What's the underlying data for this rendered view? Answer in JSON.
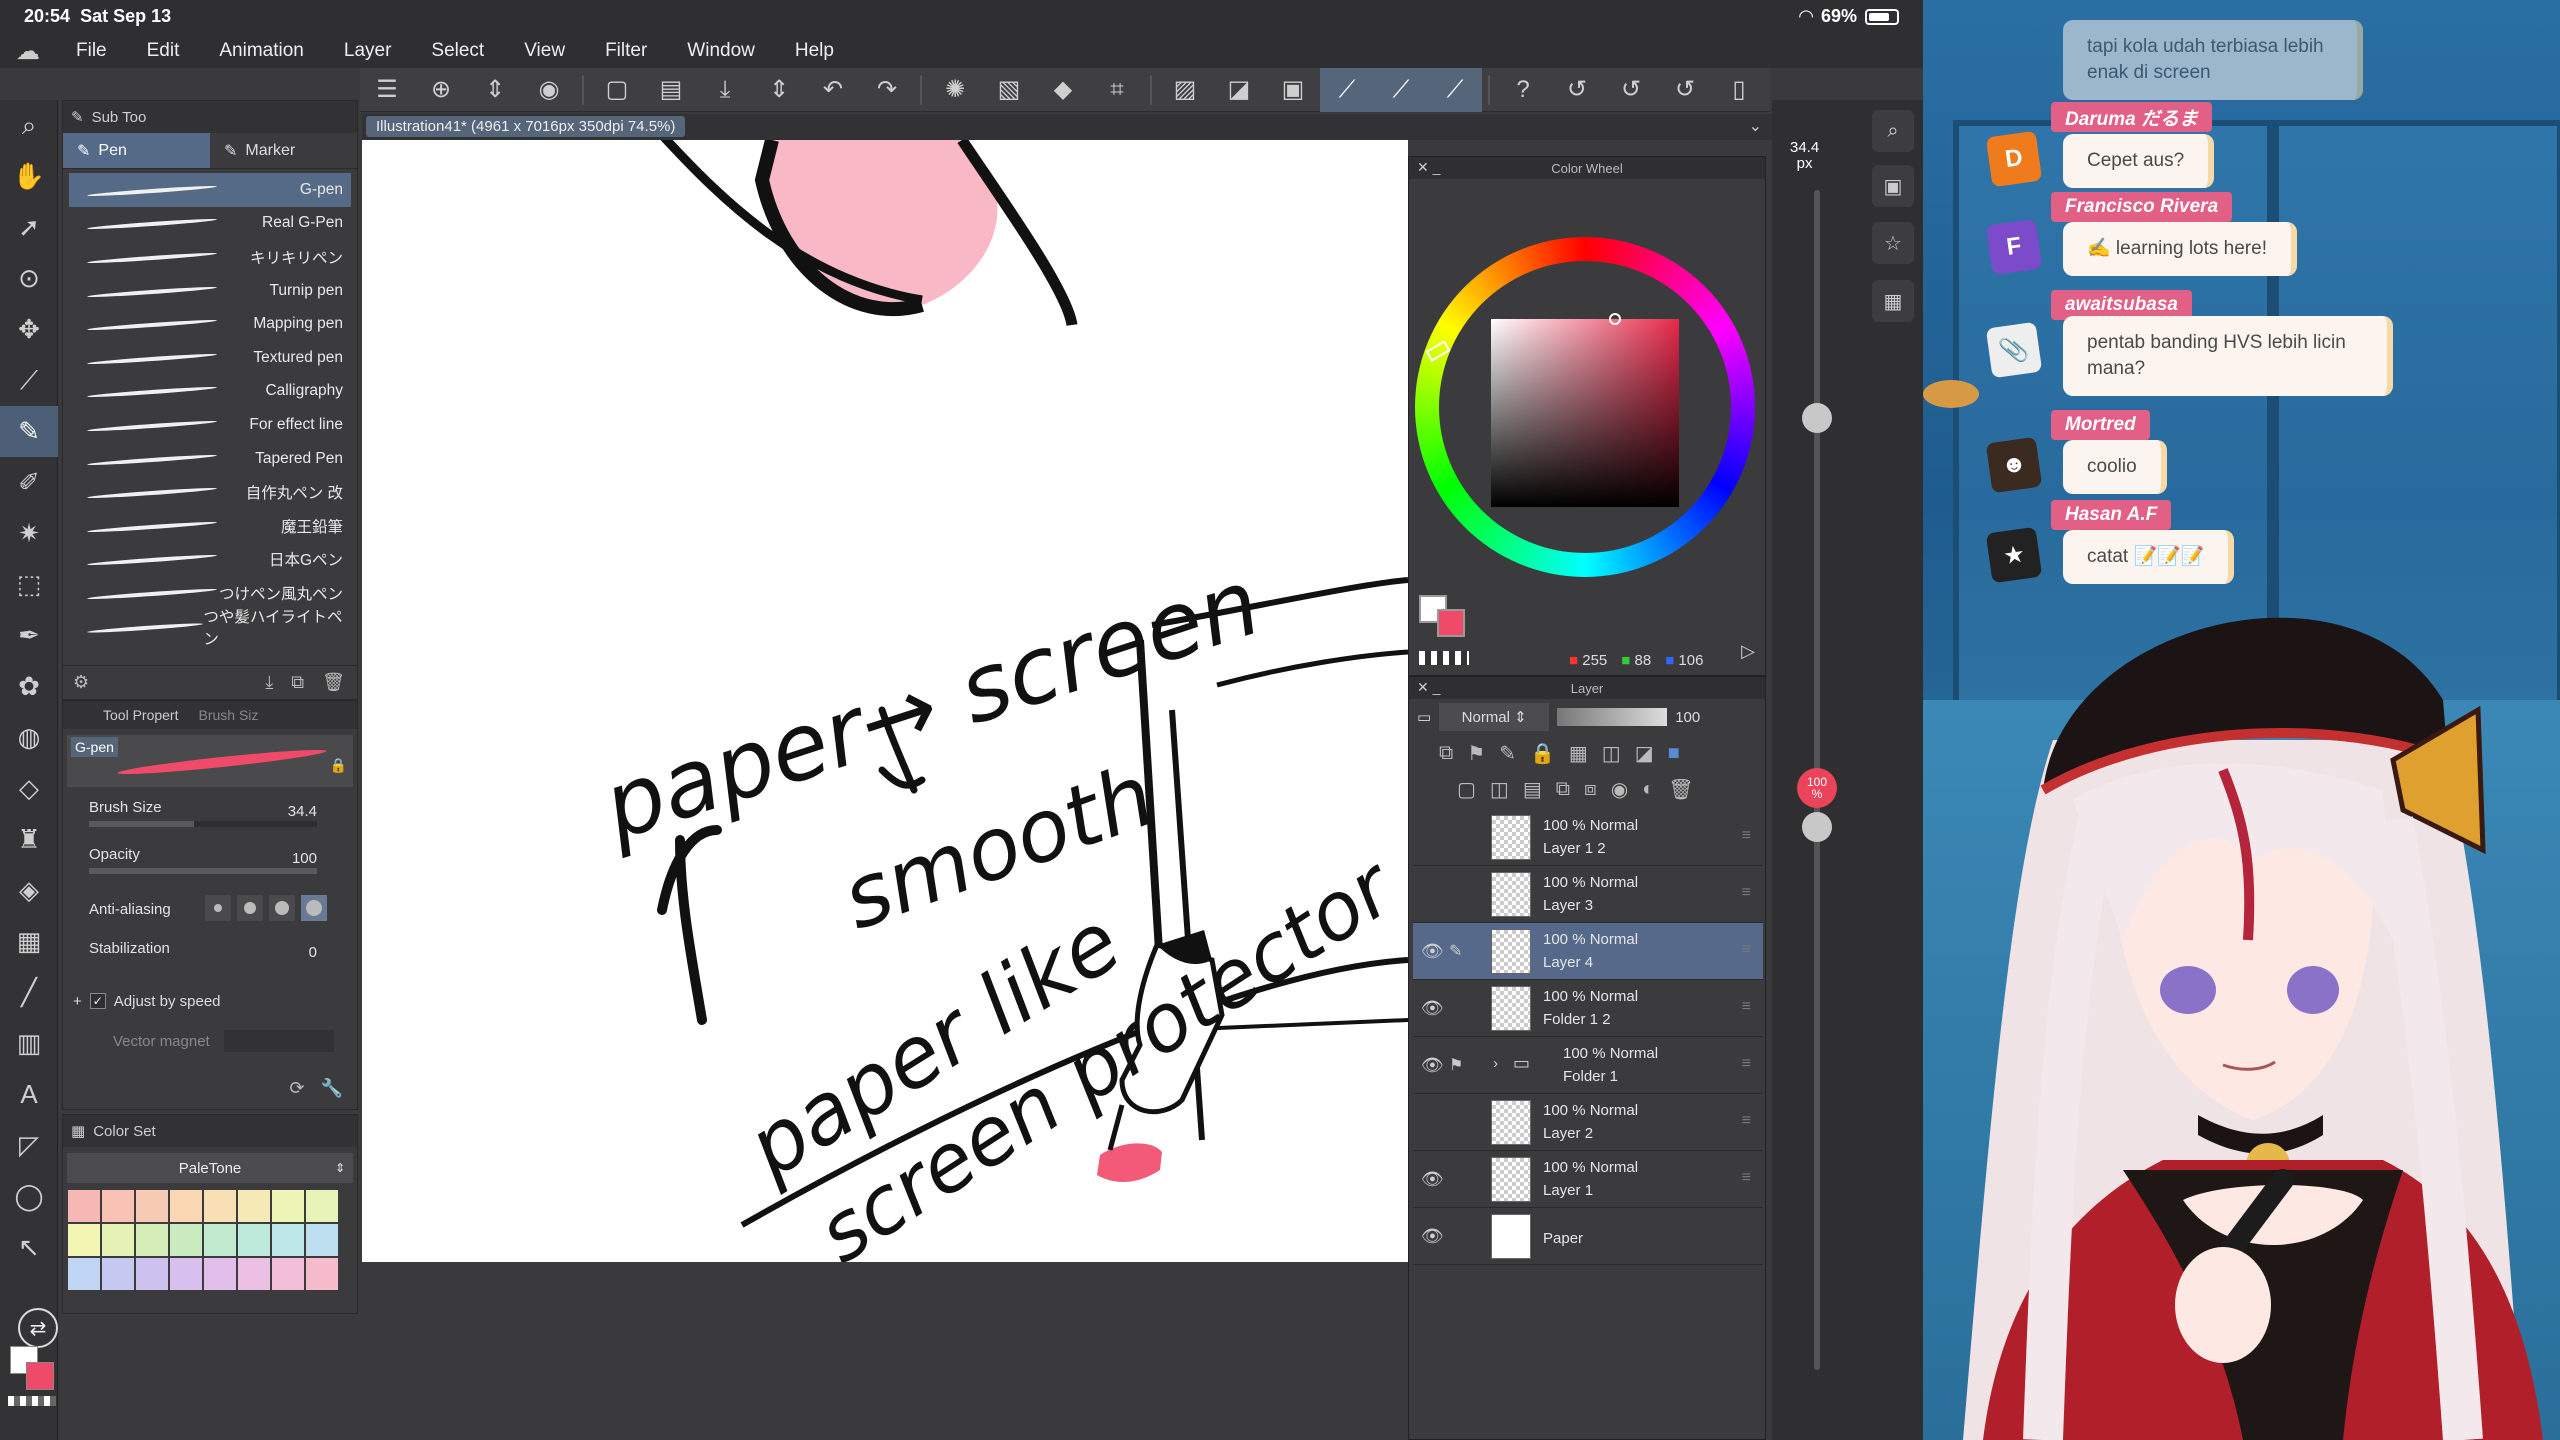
{
  "statusbar": {
    "time": "20:54",
    "date": "Sat Sep 13",
    "battery": "69%"
  },
  "menu": [
    "File",
    "Edit",
    "Animation",
    "Layer",
    "Select",
    "View",
    "Filter",
    "Window",
    "Help"
  ],
  "canvas_tab": "Illustration41* (4961 x 7016px 350dpi 74.5%)",
  "subtool": {
    "header": "Sub Too",
    "groups": [
      "Pen",
      "Marker"
    ],
    "brushes": [
      "G-pen",
      "Real G-Pen",
      "キリキリペン",
      "Turnip pen",
      "Mapping pen",
      "Textured pen",
      "Calligraphy",
      "For effect line",
      "Tapered Pen",
      "自作丸ペン 改",
      "魔王鉛筆",
      "日本Gペン",
      "つけペン風丸ペン",
      "つや髪ハイライトペン"
    ]
  },
  "toolprop": {
    "tabs": [
      "Tool Propert",
      "Brush Siz"
    ],
    "brush_name": "G-pen",
    "brush_size_label": "Brush Size",
    "brush_size_value": "34.4",
    "opacity_label": "Opacity",
    "opacity_value": "100",
    "antialias_label": "Anti-aliasing",
    "stabilization_label": "Stabilization",
    "stabilization_value": "0",
    "adjust_speed_label": "Adjust by speed",
    "vector_magnet_label": "Vector magnet"
  },
  "colorset": {
    "tab": "Color Set",
    "palette": "PaleTone",
    "colors": [
      "#f7b7b5",
      "#f9c2b4",
      "#f8cbb4",
      "#fad6b3",
      "#f9e0b4",
      "#f5eab5",
      "#eef3b6",
      "#e6f4b8",
      "#f3f5b3",
      "#e6f2b5",
      "#d6efb9",
      "#c8ecbf",
      "#c1eace",
      "#beeadc",
      "#bde7e8",
      "#bedff0",
      "#c0d4f3",
      "#c5c9f2",
      "#cdc1f0",
      "#d7bfee",
      "#e2bfeb",
      "#ecbfe4",
      "#f3bfd8",
      "#f6bccb"
    ]
  },
  "colorwheel": {
    "title": "Color Wheel",
    "r": "255",
    "g": "88",
    "b": "106"
  },
  "layer": {
    "title": "Layer",
    "blend": "Normal",
    "opacity": "100",
    "rows": [
      {
        "l1": "100 %  Normal",
        "l2": "Layer 1 2"
      },
      {
        "l1": "100 %  Normal",
        "l2": "Layer 3"
      },
      {
        "l1": "100 %  Normal",
        "l2": "Layer 4"
      },
      {
        "l1": "100 %  Normal",
        "l2": "Folder 1 2"
      },
      {
        "l1": "100 %  Normal",
        "l2": "Folder 1"
      },
      {
        "l1": "100 %  Normal",
        "l2": "Layer 2"
      },
      {
        "l1": "100 %  Normal",
        "l2": "Layer 1"
      },
      {
        "l1": "",
        "l2": "Paper"
      }
    ]
  },
  "rail": {
    "size_value": "34.4",
    "size_unit": "px",
    "opacity_value": "100",
    "opacity_unit": "%"
  },
  "drawing": {
    "line1": "paper→ screen",
    "line2": "smooth",
    "line3": "paper like",
    "line4": "screen protector"
  },
  "chat": [
    {
      "name": "",
      "message": "tapi kola udah terbiasa lebih enak di screen",
      "avatar": ""
    },
    {
      "name": "Daruma だるま",
      "message": "Cepet aus?",
      "avatar": "D",
      "avatar_color": "#f07b1c"
    },
    {
      "name": "Francisco Rivera",
      "message": "✍️ learning lots here!",
      "avatar": "F",
      "avatar_color": "#7b4bc9"
    },
    {
      "name": "awaitsubasa",
      "message": "pentab banding HVS lebih licin mana?",
      "avatar": "",
      "avatar_color": "#e8e8e8"
    },
    {
      "name": "Mortred",
      "message": "coolio",
      "avatar": "",
      "avatar_color": "#3a2a20"
    },
    {
      "name": "Hasan A.F",
      "message": "catat 📝📝📝",
      "avatar": "",
      "avatar_color": "#222"
    }
  ],
  "colors": {
    "accent_blue": "#556a86",
    "chat_name": "#e25f86",
    "brush_red": "#f04a6a"
  }
}
